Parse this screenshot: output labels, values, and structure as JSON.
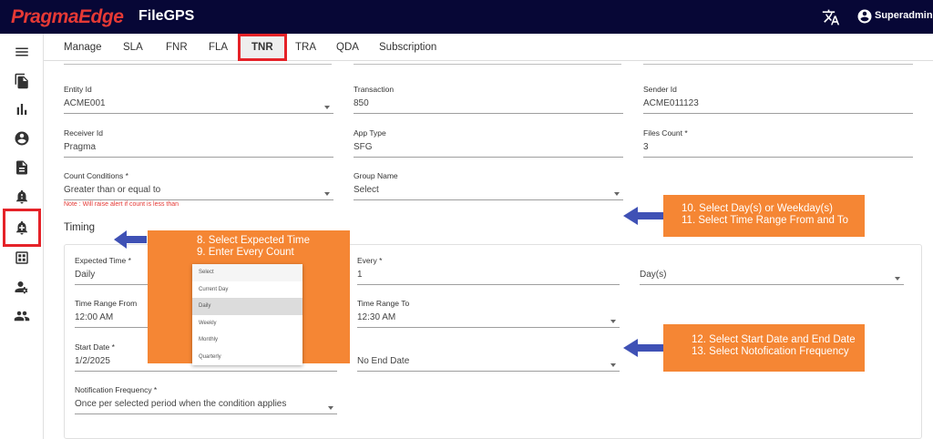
{
  "header": {
    "logo_text": "PragmaEdge",
    "product_name": "FileGPS",
    "user_name": "Superadmin"
  },
  "sidebar": {
    "icons": [
      "menu-icon",
      "files-icon",
      "bar-chart-icon",
      "account-icon",
      "document-icon",
      "alert-icon",
      "alert-add-icon",
      "dashboard-icon",
      "user-settings-icon",
      "group-icon"
    ],
    "active_index": 6
  },
  "tabs": [
    {
      "label": "Manage"
    },
    {
      "label": "SLA"
    },
    {
      "label": "FNR"
    },
    {
      "label": "FLA"
    },
    {
      "label": "TNR",
      "active": true
    },
    {
      "label": "TRA"
    },
    {
      "label": "QDA"
    },
    {
      "label": "Subscription"
    }
  ],
  "form": {
    "entity_id": {
      "label": "Entity Id",
      "value": "ACME001"
    },
    "transaction": {
      "label": "Transaction",
      "value": "850"
    },
    "sender_id": {
      "label": "Sender Id",
      "value": "ACME011123"
    },
    "receiver_id": {
      "label": "Receiver Id",
      "value": "Pragma"
    },
    "app_type": {
      "label": "App Type",
      "value": "SFG"
    },
    "files_count": {
      "label": "Files Count *",
      "value": "3"
    },
    "count_conditions": {
      "label": "Count Conditions *",
      "value": "Greater than or equal to"
    },
    "group_name": {
      "label": "Group Name",
      "value": "Select"
    },
    "note": "Note : Will raise alert if count is less than"
  },
  "timing": {
    "title": "Timing",
    "expected_time": {
      "label": "Expected Time *",
      "value": "Daily"
    },
    "every": {
      "label": "Every *",
      "value": "1"
    },
    "every_unit": {
      "value": "Day(s)"
    },
    "time_range_from": {
      "label": "Time Range From",
      "value": "12:00 AM"
    },
    "time_range_to": {
      "label": "Time Range To",
      "value": "12:30 AM"
    },
    "start_date": {
      "label": "Start Date *",
      "value": "1/2/2025"
    },
    "end_date": {
      "value": "No End Date"
    },
    "notification_frequency": {
      "label": "Notification Frequency *",
      "value": "Once per selected period when the condition applies"
    }
  },
  "dropdown_options": [
    "Select",
    "Current Day",
    "Daily",
    "Weekly",
    "Monthly",
    "Quarterly"
  ],
  "dropdown_selected": "Daily",
  "callouts": {
    "c1": [
      "8. Select Expected Time",
      "9. Enter Every Count"
    ],
    "c2": [
      "10. Select Day(s) or Weekday(s)",
      "11. Select Time Range From and To"
    ],
    "c3": [
      "12. Select Start Date and End Date",
      "13. Select Notofication Frequency"
    ]
  },
  "colors": {
    "topbar": "#070736",
    "logo": "#e53935",
    "highlight": "#e52228",
    "callout": "#f58634",
    "arrow": "#3f51b5"
  }
}
